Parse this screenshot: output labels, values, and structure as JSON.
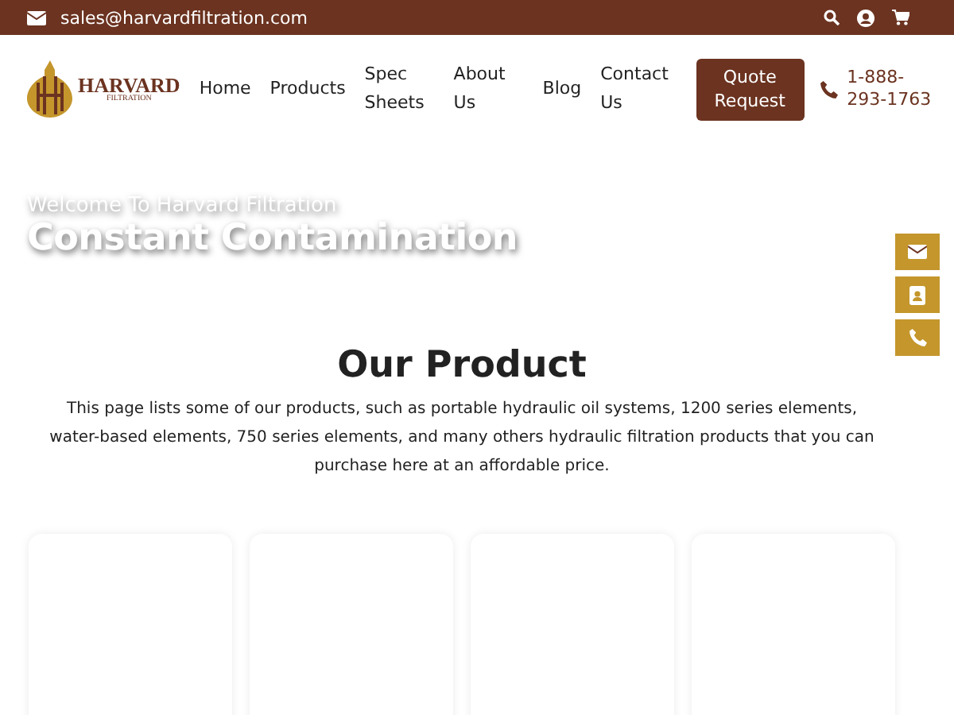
{
  "topbar": {
    "email": "sales@harvardfiltration.com"
  },
  "logo": {
    "name": "HARVARD",
    "sub": "FILTRATION"
  },
  "nav": [
    {
      "label": "Home"
    },
    {
      "label": "Products"
    },
    {
      "label": "Spec Sheets"
    },
    {
      "label": "About Us"
    },
    {
      "label": "Blog"
    },
    {
      "label": "Contact Us"
    }
  ],
  "quote_button": "Quote Request",
  "phone": "1-888-293-1763",
  "hero": {
    "kicker": "Welcome To Harvard Filtration",
    "title": "Constant Contamination"
  },
  "side_buttons": [
    {
      "kind": "mail"
    },
    {
      "kind": "contact"
    },
    {
      "kind": "phone"
    }
  ],
  "section": {
    "title": "Our Product",
    "text": "This page lists some of our products, such as portable hydraulic oil systems, 1200 series elements, water-based elements, 750 series elements, and many others hydraulic filtration products that you can purchase here at an affordable price."
  },
  "cards": [
    {
      "kind": "product"
    },
    {
      "kind": "product"
    },
    {
      "kind": "product"
    },
    {
      "kind": "product"
    }
  ]
}
